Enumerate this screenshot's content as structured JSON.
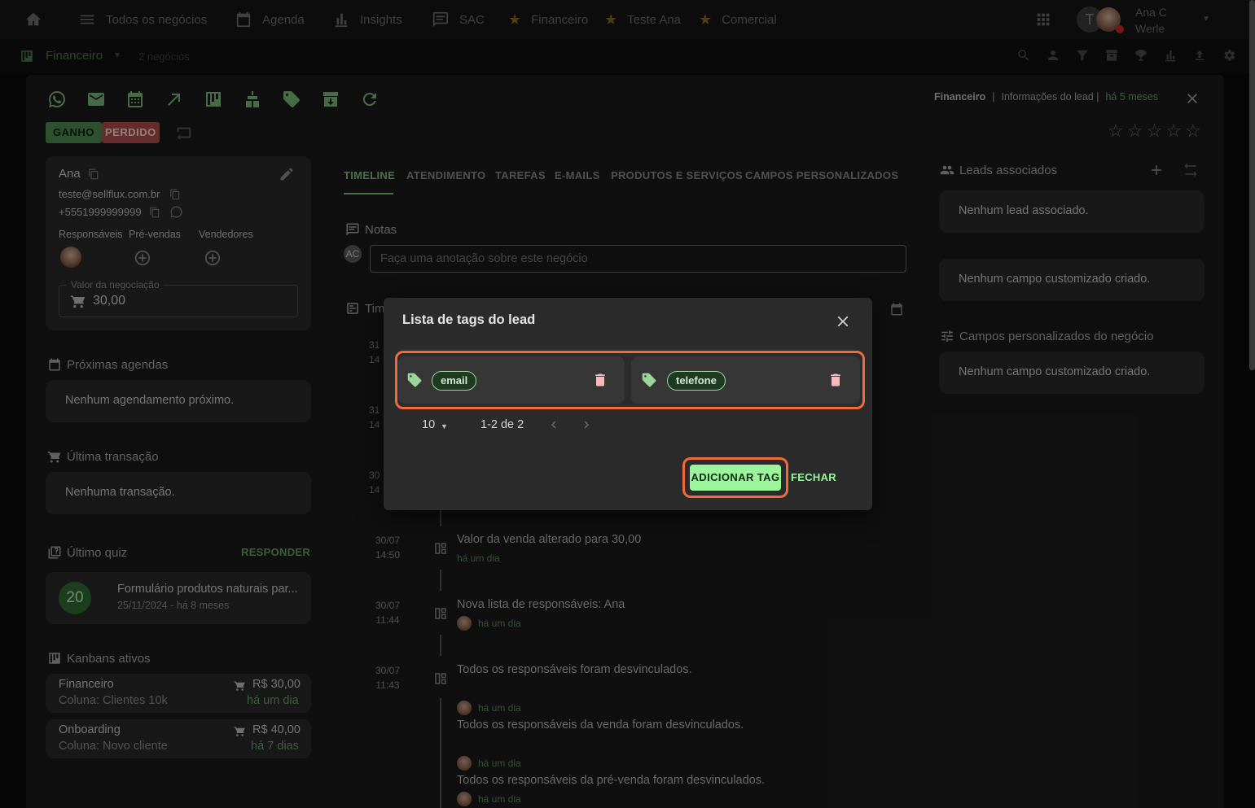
{
  "topnav": {
    "items": [
      {
        "label": "Todos os negócios",
        "icon": "list-icon"
      },
      {
        "label": "Agenda",
        "icon": "calendar-icon"
      },
      {
        "label": "Insights",
        "icon": "bar-chart-icon"
      },
      {
        "label": "SAC",
        "icon": "chat-icon"
      },
      {
        "label": "Financeiro",
        "icon": "star-icon"
      },
      {
        "label": "Teste Ana",
        "icon": "star-icon"
      },
      {
        "label": "Comercial",
        "icon": "star-icon"
      }
    ],
    "user_initial": "T",
    "user_name_line1": "Ana C",
    "user_name_line2": "Werle"
  },
  "subbar": {
    "pipeline": "Financeiro",
    "count": "2 negócios"
  },
  "header": {
    "pipeline": "Financeiro",
    "separator": "|",
    "info": "Informações do lead |",
    "time": "há 5 meses"
  },
  "status": {
    "won": "GANHO",
    "lost": "PERDIDO"
  },
  "lead": {
    "name": "Ana",
    "email": "teste@sellflux.com.br",
    "phone": "+5551999999999",
    "roles": [
      "Responsáveis",
      "Pré-vendas",
      "Vendedores"
    ],
    "value_label": "Valor da negociação",
    "value": "30,00"
  },
  "schedules": {
    "title": "Próximas agendas",
    "empty": "Nenhum agendamento próximo."
  },
  "transaction": {
    "title": "Última transação",
    "empty": "Nenhuma transação."
  },
  "quiz": {
    "title": "Último quiz",
    "action": "RESPONDER",
    "score": "20",
    "name": "Formulário produtos naturais par...",
    "date": "25/11/2024 - há 8 meses"
  },
  "kanbans": {
    "title": "Kanbans ativos",
    "items": [
      {
        "name": "Financeiro",
        "column": "Coluna: Clientes 10k",
        "value": "R$ 30,00",
        "time": "há um dia"
      },
      {
        "name": "Onboarding",
        "column": "Coluna: Novo cliente",
        "value": "R$ 40,00",
        "time": "há 7 dias"
      }
    ]
  },
  "tabs": [
    "TIMELINE",
    "ATENDIMENTO",
    "TAREFAS",
    "E-MAILS",
    "PRODUTOS E SERVIÇOS",
    "CAMPOS PERSONALIZADOS"
  ],
  "notes": {
    "title": "Notas",
    "initials": "AC",
    "placeholder": "Faça uma anotação sobre este negócio"
  },
  "timeline": {
    "title": "Tim",
    "hidden_dates": [
      "31",
      "14",
      "31",
      "14",
      "30",
      "14"
    ],
    "events": [
      {
        "date": "30/07",
        "time": "14:50",
        "text": "Valor da venda alterado para 30,00",
        "sub": "há um dia"
      },
      {
        "date": "30/07",
        "time": "11:44",
        "text": "Nova lista de responsáveis: Ana",
        "sub": "há um dia"
      },
      {
        "date": "30/07",
        "time": "11:43",
        "text": "Todos os responsáveis foram desvinculados.",
        "sub": ""
      }
    ],
    "extra": [
      {
        "sub": "há um dia",
        "text": "Todos os responsáveis da venda foram desvinculados."
      },
      {
        "sub": "há um dia",
        "text": "Todos os responsáveis da pré-venda foram desvinculados."
      },
      {
        "sub": "há um dia",
        "text": ""
      }
    ]
  },
  "right": {
    "leads_title": "Leads associados",
    "leads_empty": "Nenhum lead associado.",
    "custom_empty": "Nenhum campo customizado criado.",
    "biz_fields_title": "Campos personalizados do negócio",
    "biz_fields_empty": "Nenhum campo customizado criado."
  },
  "modal": {
    "title": "Lista de tags do lead",
    "tags": [
      "email",
      "telefone"
    ],
    "per_page": "10",
    "range": "1-2 de 2",
    "add_label": "ADICIONAR TAG",
    "close_label": "FECHAR"
  },
  "colors": {
    "accent": "#9bf59b",
    "highlight": "#f06a3a",
    "won": "#4e8a52",
    "lost": "#b04a4a"
  }
}
